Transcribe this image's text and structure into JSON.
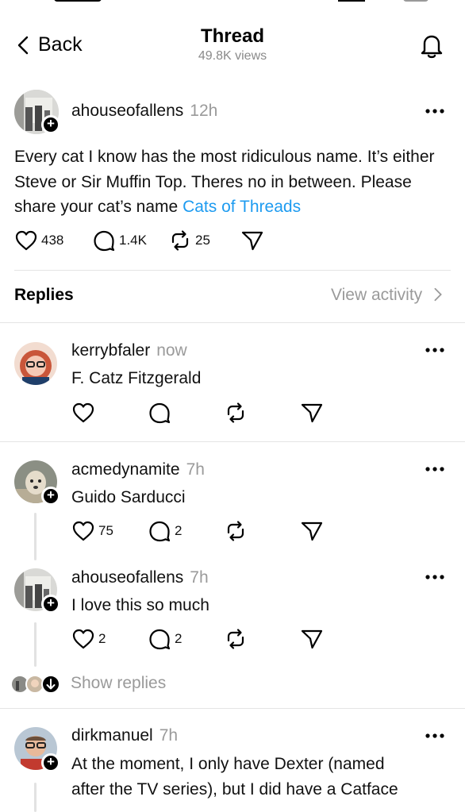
{
  "header": {
    "back_label": "Back",
    "title": "Thread",
    "views": "49.8K views"
  },
  "post": {
    "username": "ahouseofallens",
    "time": "12h",
    "text": "Every cat I know has the most ridiculous name. It’s either Steve or Sir Muffin Top. Theres no in between. Please share your cat’s name ",
    "tag": "Cats of Threads",
    "likes": "438",
    "replies": "1.4K",
    "reposts": "25"
  },
  "replies_section": {
    "title": "Replies",
    "view_activity": "View activity"
  },
  "replies": [
    {
      "username": "kerrybfaler",
      "time": "now",
      "text": "F. Catz Fitzgerald",
      "likes": "",
      "replies": ""
    },
    {
      "username": "acmedynamite",
      "time": "7h",
      "text": "Guido Sarducci",
      "likes": "75",
      "replies": "2"
    },
    {
      "username": "ahouseofallens",
      "time": "7h",
      "text": "I love this so much",
      "likes": "2",
      "replies": "2"
    },
    {
      "username": "dirkmanuel",
      "time": "7h",
      "text_line1": "At the moment, I only have Dexter (named",
      "text_line2": "after the TV series), but I did have a Catface"
    }
  ],
  "show_replies": "Show replies",
  "colors": {
    "link": "#1d9bf0",
    "muted": "#9a9a9a"
  }
}
